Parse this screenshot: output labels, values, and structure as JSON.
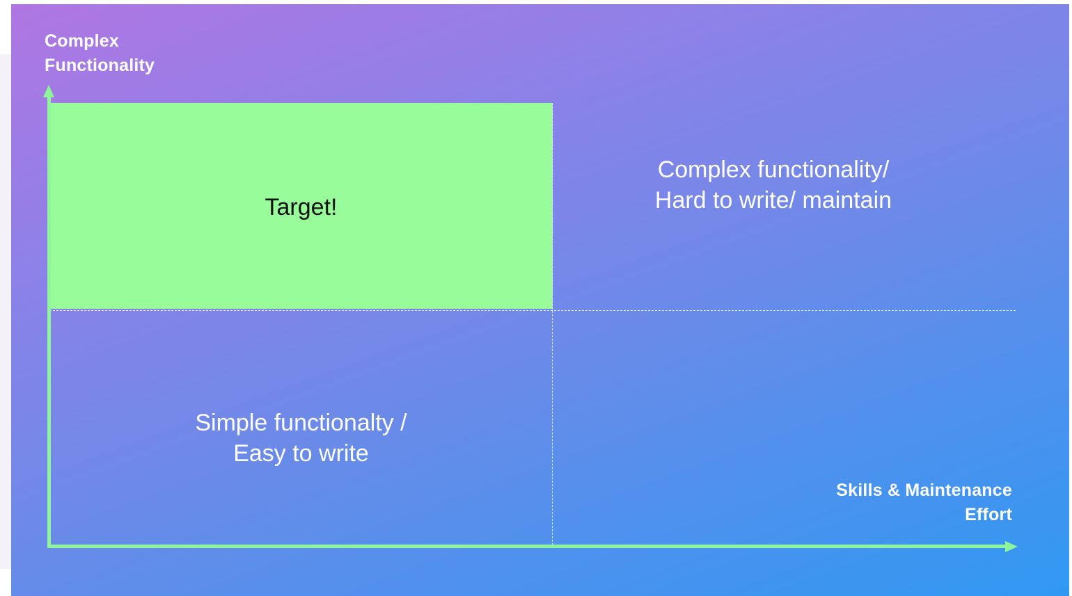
{
  "axes": {
    "y_label_line1": "Complex",
    "y_label_line2": "Functionality",
    "x_label_line1": "Skills & Maintenance",
    "x_label_line2": "Effort"
  },
  "quadrants": {
    "target": "Target!",
    "top_right_line1": "Complex functionality/",
    "top_right_line2": "Hard to write/ maintain",
    "bottom_left_line1": "Simple functionalty /",
    "bottom_left_line2": "Easy to write"
  },
  "colors": {
    "gradient_start": "#b076e2",
    "gradient_end": "#3098f2",
    "target_fill": "#98fc9a",
    "axis": "#8ff59a"
  }
}
